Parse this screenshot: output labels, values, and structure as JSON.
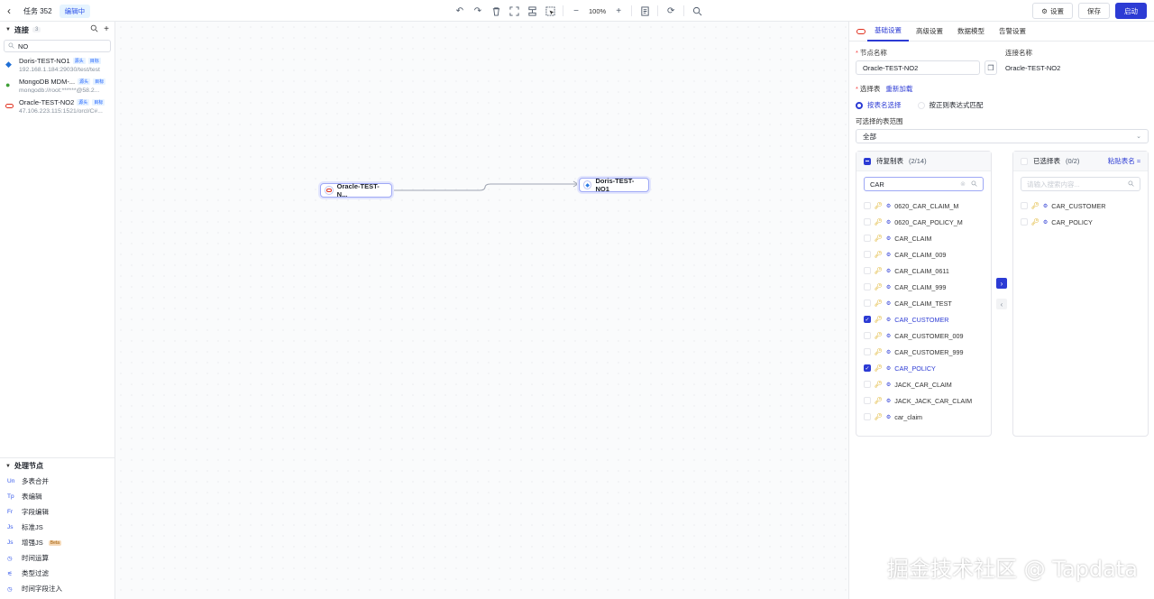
{
  "topbar": {
    "task_title": "任务 352",
    "status_badge": "编辑中",
    "zoom": "100%",
    "settings_label": "设置",
    "save_label": "保存",
    "start_label": "启动"
  },
  "left": {
    "connections_title": "连接",
    "connections_count": "3",
    "search_value": "NO",
    "connections": [
      {
        "name": "Doris-TEST-NO1",
        "address": "192.168.1.184:29030/test/test",
        "icon": "doris-icon",
        "tags": [
          "源头",
          "目标"
        ]
      },
      {
        "name": "MongoDB MDM-...",
        "address": "mongodb://root:******@58.2...",
        "icon": "mongodb-icon",
        "tags": [
          "源头",
          "目标"
        ]
      },
      {
        "name": "Oracle-TEST-NO2",
        "address": "47.106.223.115:1521/orcl/C#...",
        "icon": "oracle-icon",
        "tags": [
          "源头",
          "目标"
        ]
      }
    ],
    "process_title": "处理节点",
    "process_nodes": [
      {
        "abbr": "Un",
        "label": "多表合并",
        "beta": ""
      },
      {
        "abbr": "Tp",
        "label": "表编辑",
        "beta": ""
      },
      {
        "abbr": "Fr",
        "label": "字段编辑",
        "beta": ""
      },
      {
        "abbr": "Js",
        "label": "标准JS",
        "beta": ""
      },
      {
        "abbr": "Js",
        "label": "增强JS",
        "beta": "Beta"
      },
      {
        "abbr": "◷",
        "label": "时间运算",
        "beta": ""
      },
      {
        "abbr": "⚟",
        "label": "类型过滤",
        "beta": ""
      },
      {
        "abbr": "◷",
        "label": "时间字段注入",
        "beta": ""
      }
    ]
  },
  "canvas": {
    "source_node": "Oracle-TEST-N...",
    "target_node": "Doris-TEST-NO1"
  },
  "right": {
    "tabs": [
      "基础设置",
      "高级设置",
      "数据模型",
      "告警设置"
    ],
    "node_name_label": "节点名称",
    "node_name_value": "Oracle-TEST-NO2",
    "conn_name_label": "连接名称",
    "conn_name_value": "Oracle-TEST-NO2",
    "select_table_label": "选择表",
    "reload_label": "重新加载",
    "radio_by_name": "按表名选择",
    "radio_by_regex": "按正则表达式匹配",
    "range_label": "可选择的表范围",
    "range_value": "全部",
    "left_box": {
      "title": "待复制表",
      "count": "(2/14)",
      "search_value": "CAR",
      "tables": [
        {
          "name": "0620_CAR_CLAIM_M",
          "checked": false
        },
        {
          "name": "0620_CAR_POLICY_M",
          "checked": false
        },
        {
          "name": "CAR_CLAIM",
          "checked": false
        },
        {
          "name": "CAR_CLAIM_009",
          "checked": false
        },
        {
          "name": "CAR_CLAIM_0611",
          "checked": false
        },
        {
          "name": "CAR_CLAIM_999",
          "checked": false
        },
        {
          "name": "CAR_CLAIM_TEST",
          "checked": false
        },
        {
          "name": "CAR_CUSTOMER",
          "checked": true
        },
        {
          "name": "CAR_CUSTOMER_009",
          "checked": false
        },
        {
          "name": "CAR_CUSTOMER_999",
          "checked": false
        },
        {
          "name": "CAR_POLICY",
          "checked": true
        },
        {
          "name": "JACK_CAR_CLAIM",
          "checked": false
        },
        {
          "name": "JACK_JACK_CAR_CLAIM",
          "checked": false
        },
        {
          "name": "car_claim",
          "checked": false
        }
      ]
    },
    "right_box": {
      "title": "已选择表",
      "count": "(0/2)",
      "paste_label": "粘贴表名",
      "search_placeholder": "请输入搜索内容...",
      "tables": [
        {
          "name": "CAR_CUSTOMER"
        },
        {
          "name": "CAR_POLICY"
        }
      ]
    }
  },
  "watermark": "掘金技术社区 @ Tapdata"
}
